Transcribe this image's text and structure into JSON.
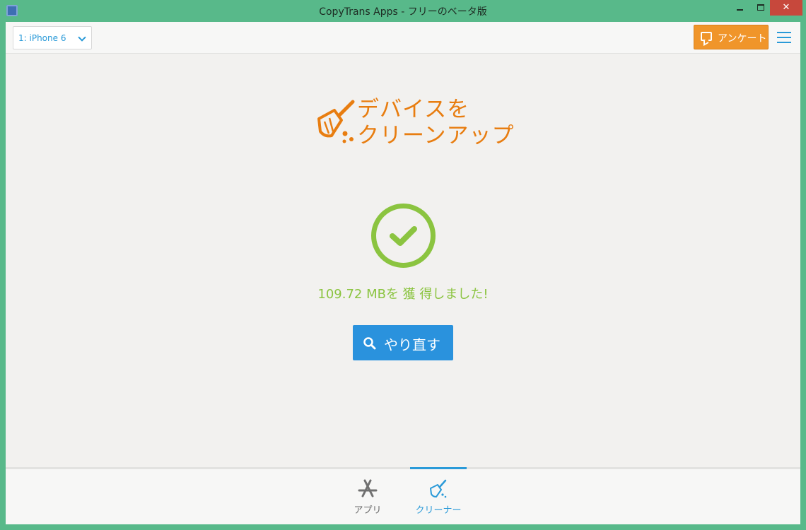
{
  "window": {
    "title": "CopyTrans Apps - フリーのベータ版"
  },
  "topbar": {
    "device": "1: iPhone 6",
    "survey_label": "アンケート"
  },
  "logo": {
    "line1": "デバイスを",
    "line2": "クリーンアップ"
  },
  "result": {
    "text": "109.72 MBを 獲 得しました!"
  },
  "retry": {
    "label": "やり直す"
  },
  "nav": {
    "tabs": [
      {
        "label": "アプリ",
        "active": false
      },
      {
        "label": "クリーナー",
        "active": true
      }
    ]
  },
  "colors": {
    "frame": "#58b98a",
    "accent": "#2a9ad8",
    "orange": "#e87d10",
    "success": "#8bc440",
    "close": "#c7483c"
  }
}
